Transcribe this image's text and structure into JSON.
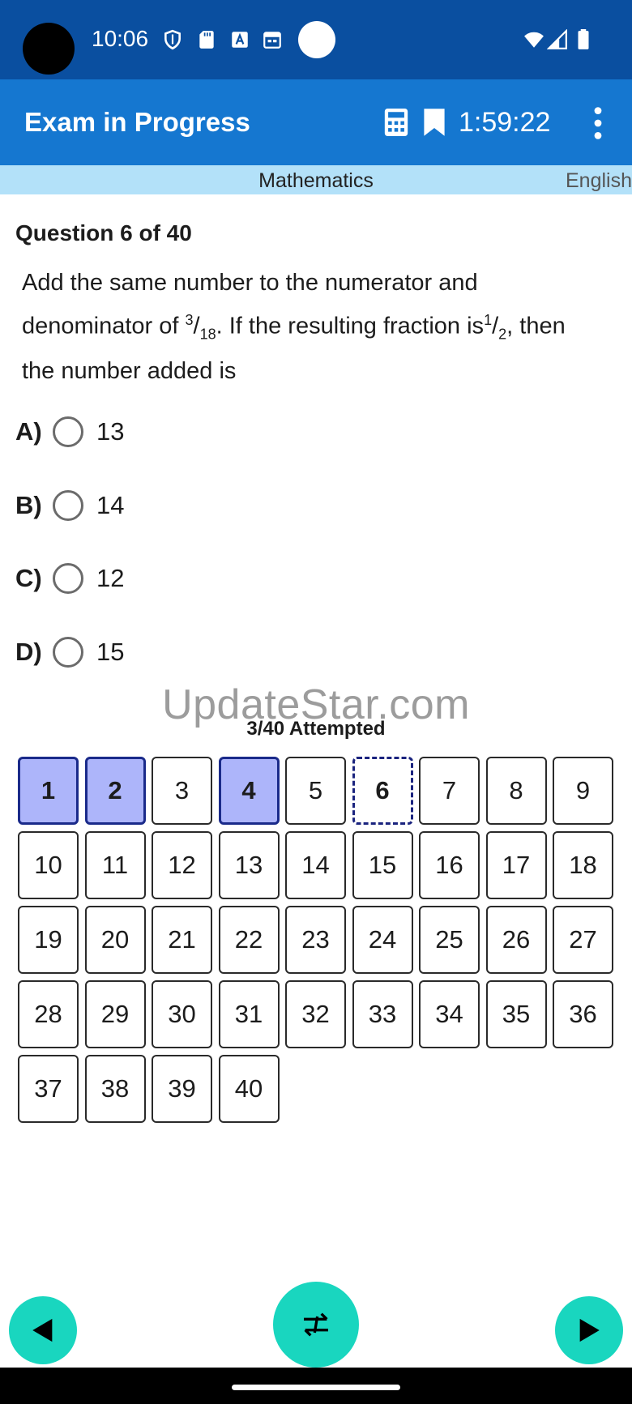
{
  "status_bar": {
    "time": "10:06"
  },
  "app_bar": {
    "title": "Exam in Progress",
    "timer": "1:59:22",
    "icons": [
      "calculator-icon",
      "bookmark-icon",
      "more-vert-icon"
    ]
  },
  "subject_bar": {
    "subject": "Mathematics",
    "language": "English"
  },
  "question": {
    "header": "Question 6 of 40",
    "line1": "Add the same number to the numerator and",
    "line2_a": "denominator of ",
    "frac1_num": "3",
    "frac1_den": "18",
    "line2_b": ". If the resulting fraction is",
    "frac2_num": "1",
    "frac2_den": "2",
    "line2_c": ", then",
    "line3": "the number added is"
  },
  "options": [
    {
      "letter": "A)",
      "text": "13"
    },
    {
      "letter": "B)",
      "text": "14"
    },
    {
      "letter": "C)",
      "text": "12"
    },
    {
      "letter": "D)",
      "text": "15"
    }
  ],
  "watermark": "UpdateStar.com",
  "attempted_label": "3/40 Attempted",
  "question_grid": {
    "numbers": [
      "1",
      "2",
      "3",
      "4",
      "5",
      "6",
      "7",
      "8",
      "9",
      "10",
      "11",
      "12",
      "13",
      "14",
      "15",
      "16",
      "17",
      "18",
      "19",
      "20",
      "21",
      "22",
      "23",
      "24",
      "25",
      "26",
      "27",
      "28",
      "29",
      "30",
      "31",
      "32",
      "33",
      "34",
      "35",
      "36",
      "37",
      "38",
      "39",
      "40"
    ],
    "attempted": [
      "1",
      "2",
      "4"
    ],
    "current": "6"
  },
  "colors": {
    "status_bar": "#0a4fa0",
    "app_bar": "#1577d0",
    "subject_bar": "#b3e1f9",
    "attempted_fill": "#adb5fa",
    "fab": "#19d6bf"
  }
}
